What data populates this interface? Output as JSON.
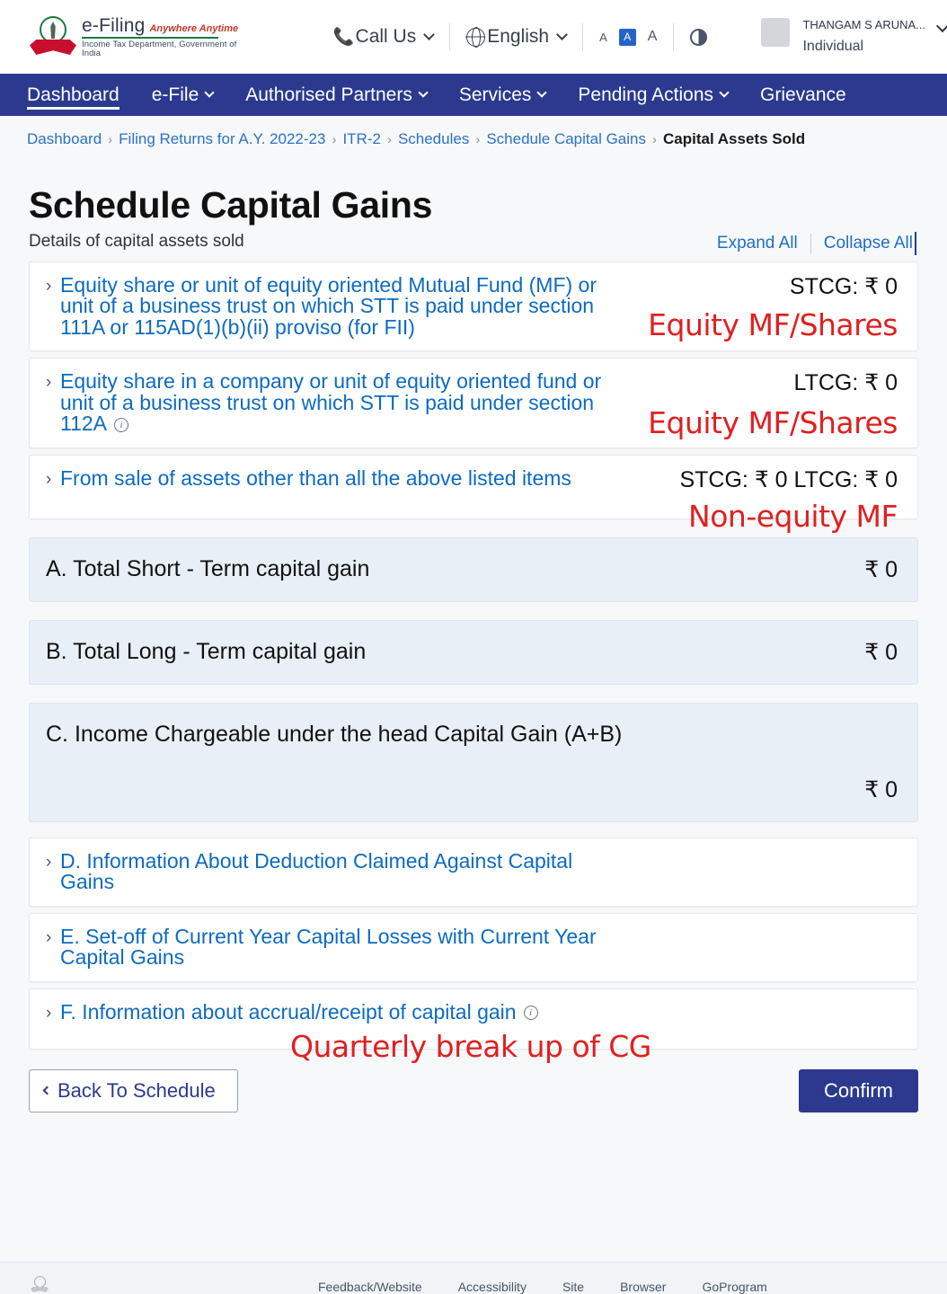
{
  "header": {
    "brand": {
      "emblem_icon": "india-emblem-icon",
      "name": "e-Filing",
      "tagline": "Anywhere Anytime",
      "department": "Income Tax Department, Government of India"
    },
    "call_us": "Call Us",
    "language": "English",
    "accessibility": {
      "decrease_label": "A",
      "normal_label": "A",
      "increase_label": "A",
      "contrast_icon": "contrast-icon"
    },
    "user": {
      "name": "THANGAM S ARUNA...",
      "type": "Individual",
      "avatar_icon": "avatar-icon"
    }
  },
  "nav": {
    "items": [
      {
        "label": "Dashboard",
        "has_caret": false,
        "active": true
      },
      {
        "label": "e-File",
        "has_caret": true,
        "active": false
      },
      {
        "label": "Authorised Partners",
        "has_caret": true,
        "active": false
      },
      {
        "label": "Services",
        "has_caret": true,
        "active": false
      },
      {
        "label": "Pending Actions",
        "has_caret": true,
        "active": false
      },
      {
        "label": "Grievance",
        "has_caret": false,
        "active": false
      }
    ]
  },
  "breadcrumb": {
    "items": [
      "Dashboard",
      "Filing Returns for A.Y. 2022-23",
      "ITR-2",
      "Schedules",
      "Schedule Capital Gains"
    ],
    "current": "Capital Assets Sold",
    "separator": "›"
  },
  "main": {
    "title": "Schedule Capital Gains",
    "subtitle": "Details of capital assets sold",
    "expand_all": "Expand All",
    "collapse_all": "Collapse All",
    "accordions": [
      {
        "label": "Equity share or unit of equity oriented Mutual Fund (MF) or unit of a business trust on which STT is paid under section 111A or 115AD(1)(b)(ii) proviso (for FII)",
        "amount": "STCG: ₹ 0",
        "annotation": "Equity MF/Shares",
        "has_info": false
      },
      {
        "label": "Equity share in a company or unit of equity oriented fund or unit of a business trust on which STT is paid under section 112A",
        "amount": "LTCG: ₹ 0",
        "annotation": "Equity MF/Shares",
        "has_info": true
      },
      {
        "label": "From sale of assets other than all the above listed items",
        "amount": "STCG: ₹ 0  LTCG: ₹ 0",
        "annotation": "Non-equity MF",
        "has_info": false
      }
    ],
    "summaries": [
      {
        "label": "A. Total Short - Term capital gain",
        "amount": "₹ 0",
        "stacked": false
      },
      {
        "label": "B. Total Long - Term capital gain",
        "amount": "₹ 0",
        "stacked": false
      },
      {
        "label": "C. Income Chargeable under the head Capital Gain (A+B)",
        "amount": "₹ 0",
        "stacked": true
      }
    ],
    "sections": [
      {
        "label": "D. Information About Deduction Claimed Against Capital Gains",
        "annotation": "",
        "has_info": false
      },
      {
        "label": "E. Set-off of Current Year Capital Losses with Current Year Capital Gains",
        "annotation": "",
        "has_info": false
      },
      {
        "label": "F. Information about accrual/receipt of capital gain",
        "annotation": "Quarterly break up of CG",
        "has_info": true
      }
    ],
    "back_button": "Back To Schedule",
    "confirm_button": "Confirm"
  },
  "footer": {
    "links": [
      "Feedback/Website",
      "Accessibility",
      "Site",
      "Browser",
      "GoProgram"
    ]
  },
  "colors": {
    "nav_blue": "#2b3a8f",
    "link_blue": "#0d6bbf",
    "annotation_red": "#e02020",
    "summary_bg": "#e9eff7"
  }
}
